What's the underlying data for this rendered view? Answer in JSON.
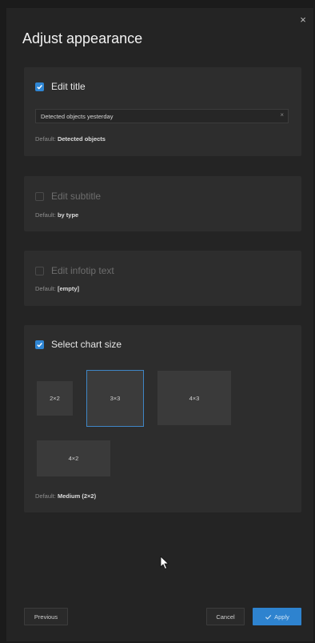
{
  "dialog": {
    "title": "Adjust appearance",
    "close_label": "×"
  },
  "edit_title": {
    "checkbox_label": "Edit title",
    "checked": true,
    "input_value": "Detected objects yesterday",
    "clear_label": "×",
    "default_prefix": "Default:",
    "default_value": "Detected objects"
  },
  "edit_subtitle": {
    "checkbox_label": "Edit subtitle",
    "checked": false,
    "default_prefix": "Default:",
    "default_value": "by type"
  },
  "edit_infotip": {
    "checkbox_label": "Edit infotip text",
    "checked": false,
    "default_prefix": "Default:",
    "default_value": "[empty]"
  },
  "chart_size": {
    "checkbox_label": "Select chart size",
    "checked": true,
    "options": [
      {
        "label": "2×2",
        "selected": false
      },
      {
        "label": "3×3",
        "selected": true
      },
      {
        "label": "4×3",
        "selected": false
      },
      {
        "label": "4×2",
        "selected": false
      }
    ],
    "default_prefix": "Default:",
    "default_value": "Medium (2×2)"
  },
  "footer": {
    "previous_label": "Previous",
    "cancel_label": "Cancel",
    "apply_label": "Apply"
  },
  "colors": {
    "accent": "#2f86d4",
    "panel": "#242424",
    "card": "#2d2d2d"
  }
}
